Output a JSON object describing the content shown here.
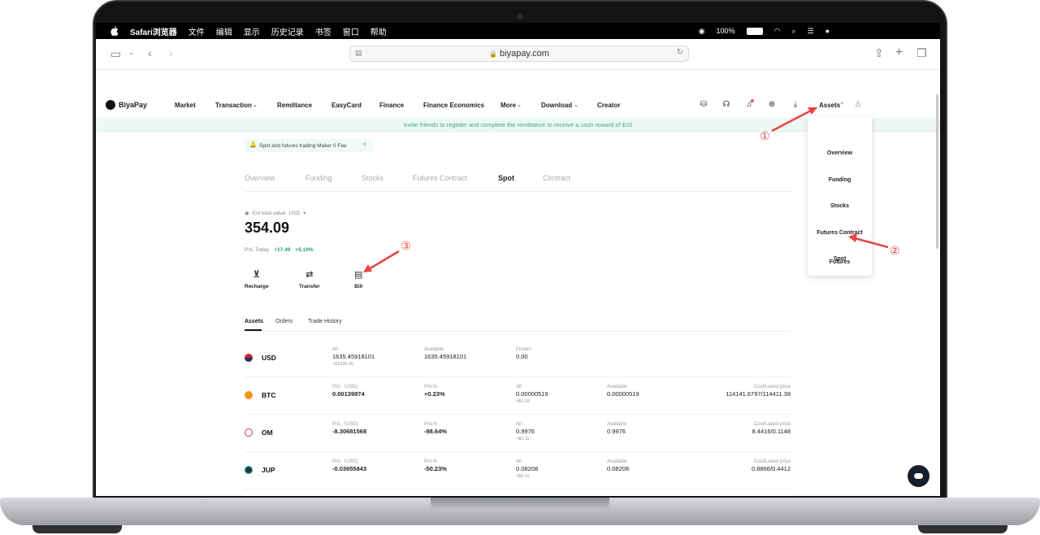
{
  "menubar": {
    "app": "Safari浏览器",
    "items": [
      "文件",
      "编辑",
      "显示",
      "历史记录",
      "书签",
      "窗口",
      "帮助"
    ],
    "battery": "100%"
  },
  "browser": {
    "url": "biyapay.com"
  },
  "site": {
    "brand": "BiyaPay",
    "nav": [
      "Market",
      "Transaction",
      "Remittance",
      "EasyCard",
      "Finance",
      "Finance Economics",
      "More",
      "Download",
      "Creator"
    ],
    "assets_menu": "Assets",
    "banner": "Invite friends to register and complete the remittance to receive a cash reward of $10",
    "promo": "Spot and futures trading Maker 0 Fee"
  },
  "tabs": [
    "Overview",
    "Funding",
    "Stocks",
    "Futures Contract",
    "Spot",
    "Contract"
  ],
  "summary": {
    "est_label": "Est total value",
    "currency": "USD",
    "total": "354.09",
    "pnl_label": "PnL Today",
    "pnl_value": "+17.49",
    "pnl_pct": "+5.19%"
  },
  "actions": [
    "Recharge",
    "Transfer",
    "Bill"
  ],
  "subtabs": [
    "Assets",
    "Orders",
    "Trade History"
  ],
  "rows": [
    {
      "symbol": "USD",
      "c1_label": "All",
      "c1": "1635.45918101",
      "c1_sub": "≈$1635.45",
      "c2_label": "Available",
      "c2": "1635.45918101",
      "c3_label": "Frozen",
      "c3": "0.00"
    },
    {
      "symbol": "BTC",
      "c1_label": "PnL（USD)",
      "c1": "0.00139974",
      "c2_label": "PnL%",
      "c2": "+0.23%",
      "c3_label": "All",
      "c3": "0.00000519",
      "c3_sub": "≈$0.59",
      "c4_label": "Available",
      "c4": "0.00000519",
      "c5_label": "Cost/Latest price",
      "c5": "114141.6797/114411.38"
    },
    {
      "symbol": "OM",
      "c1_label": "PnL（USD)",
      "c1": "-8.30681568",
      "c2_label": "PnL%",
      "c2": "-98.64%",
      "c3_label": "All",
      "c3": "0.9976",
      "c3_sub": "≈$0.11",
      "c4_label": "Available",
      "c4": "0.9976",
      "c5_label": "Cost/Latest price",
      "c5": "8.4416/0.1148"
    },
    {
      "symbol": "JUP",
      "c1_label": "PnL（USD)",
      "c1": "-0.03655843",
      "c2_label": "PnL%",
      "c2": "-50.23%",
      "c3_label": "All",
      "c3": "0.08208",
      "c3_sub": "≈$0.03",
      "c4_label": "Available",
      "c4": "0.08208",
      "c5_label": "Cost/Latest price",
      "c5": "0.8866/0.4412"
    }
  ],
  "dropdown": [
    "Overview",
    "Funding",
    "Stocks",
    "Futures Contract",
    "Spot",
    "Futures"
  ],
  "annotations": [
    "①",
    "②",
    "③"
  ],
  "colors": {
    "accent": "#22a06b",
    "loss": "#e5484d",
    "annotation": "#e84545"
  }
}
